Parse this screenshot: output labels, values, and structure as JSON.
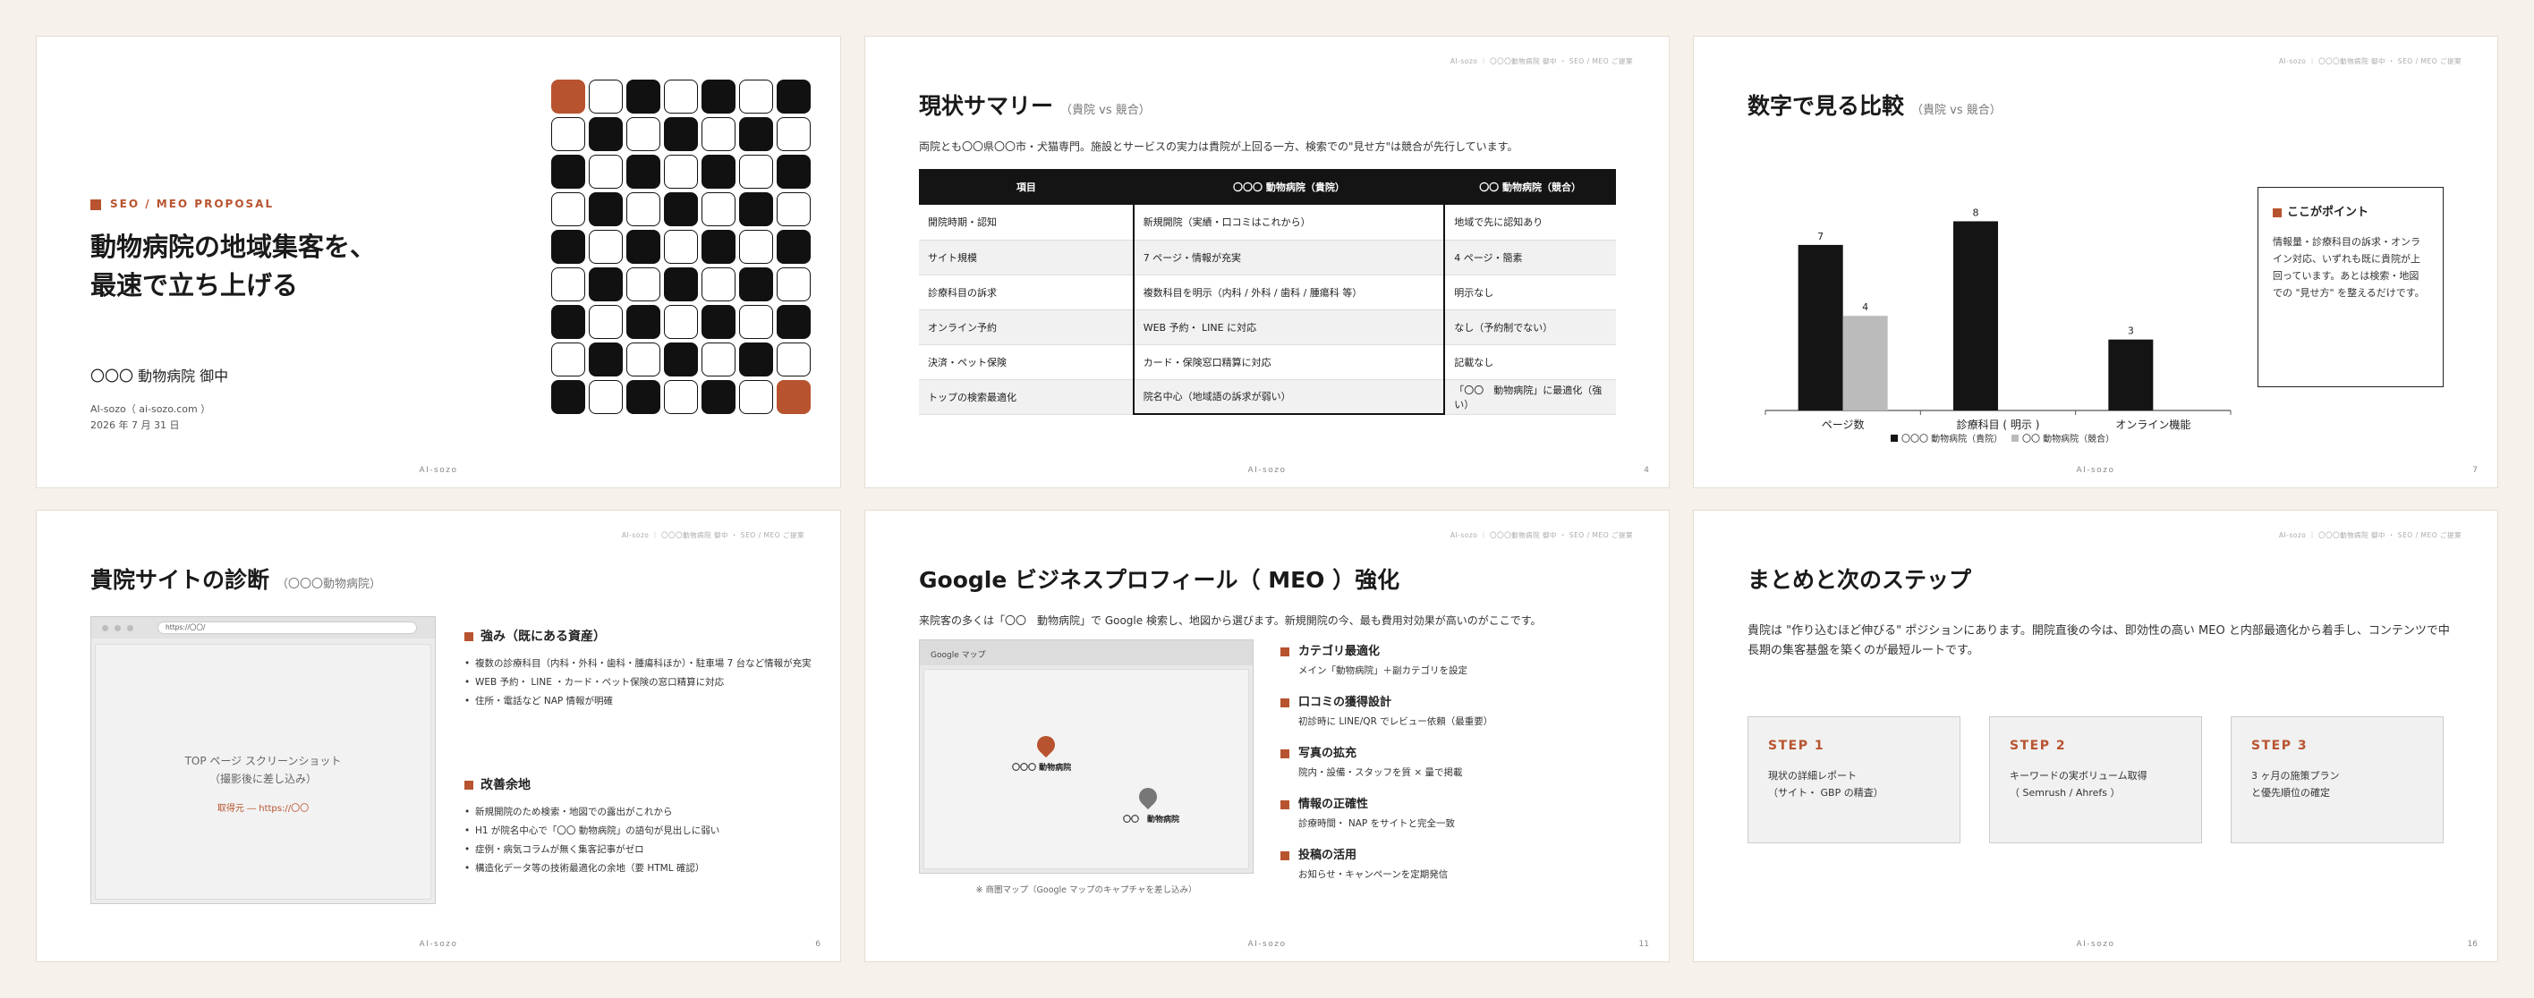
{
  "common": {
    "brand": "AI-sozo",
    "header": "AI-sozo ｜ 〇〇〇動物病院 御中 ・ SEO / MEO ご提案"
  },
  "colors": {
    "accent": "#b8532f",
    "dark": "#141414",
    "gray_bar": "#bbbbbb"
  },
  "s1": {
    "tag": "SEO / MEO PROPOSAL",
    "title_line1": "動物病院の地域集客を、",
    "title_line2": "最速で立ち上げる",
    "client": "〇〇〇 動物病院 御中",
    "author": "AI-sozo（ ai-sozo.com ）",
    "date": "2026 年 7 月 31 日"
  },
  "s2": {
    "title": "現状サマリー",
    "subtitle": "（貴院 vs 競合）",
    "lead": "両院とも〇〇県〇〇市・犬猫専門。施設とサービスの実力は貴院が上回る一方、検索での\"見せ方\"は競合が先行しています。",
    "page": "4",
    "table": {
      "headers": [
        "項目",
        "〇〇〇 動物病院（貴院）",
        "〇〇 動物病院（競合）"
      ],
      "rows": [
        [
          "開院時期・認知",
          "新規開院（実績・口コミはこれから）",
          "地域で先に認知あり"
        ],
        [
          "サイト規模",
          "7 ページ・情報が充実",
          "4 ページ・簡素"
        ],
        [
          "診療科目の訴求",
          "複数科目を明示（内科 / 外科 / 歯科 / 腫瘍科 等）",
          "明示なし"
        ],
        [
          "オンライン予約",
          "WEB 予約・ LINE に対応",
          "なし（予約制でない）"
        ],
        [
          "決済・ペット保険",
          "カード・保険窓口精算に対応",
          "記載なし"
        ],
        [
          "トップの検索最適化",
          "院名中心（地域語の訴求が弱い）",
          "「〇〇　動物病院」に最適化（強い）"
        ]
      ]
    }
  },
  "s3": {
    "title": "数字で見る比較",
    "subtitle": "（貴院 vs 競合）",
    "page": "7",
    "point_title": "ここがポイント",
    "point_text": "情報量・診療科目の訴求・オンライン対応、いずれも既に貴院が上回っています。あとは検索・地図での \"見せ方\" を整えるだけです。"
  },
  "chart_data": {
    "type": "bar",
    "categories": [
      "ページ数",
      "診療科目 ( 明示 )",
      "オンライン機能"
    ],
    "series": [
      {
        "name": "〇〇〇 動物病院（貴院）",
        "values": [
          7,
          8,
          3
        ],
        "color": "#141414"
      },
      {
        "name": "〇〇 動物病院（競合）",
        "values": [
          4,
          0,
          0
        ],
        "color": "#bbbbbb"
      }
    ],
    "data_labels": [
      [
        "7",
        "8",
        "3"
      ],
      [
        "4",
        "",
        ""
      ]
    ],
    "ylim": [
      0,
      9
    ],
    "legend": "bottom",
    "grid": false
  },
  "s4": {
    "title": "貴院サイトの診断",
    "subtitle": "（〇〇〇動物病院）",
    "page": "6",
    "url": "https://〇〇/",
    "placeholder_line1": "TOP ページ スクリーンショット",
    "placeholder_line2": "（撮影後に差し込み）",
    "placeholder_src": "取得元 ― https://〇〇",
    "strengths_title": "強み（既にある資産）",
    "strengths": [
      "複数の診療科目（内科・外科・歯科・腫瘍科ほか）・駐車場 7 台など情報が充実",
      "WEB 予約・ LINE ・カード・ペット保険の窓口精算に対応",
      "住所・電話など NAP 情報が明確"
    ],
    "improve_title": "改善余地",
    "improve": [
      "新規開院のため検索・地図での露出がこれから",
      "H1 が院名中心で「〇〇 動物病院」の語句が見出しに弱い",
      "症例・病気コラムが無く集客記事がゼロ",
      "構造化データ等の技術最適化の余地（要 HTML 確認）"
    ]
  },
  "s5": {
    "title": "Google ビジネスプロフィール（ MEO ）強化",
    "lead": "来院客の多くは「〇〇　動物病院」で Google 検索し、地図から選びます。新規開院の今、最も費用対効果が高いのがここです。",
    "page": "11",
    "map_label": "Google マップ",
    "pin1": "〇〇〇 動物病院",
    "pin2": "〇〇　動物病院",
    "map_note": "※ 商圏マップ（Google マップのキャプチャを差し込み）",
    "items": [
      {
        "title": "カテゴリ最適化",
        "desc": "メイン「動物病院」＋副カテゴリを設定"
      },
      {
        "title": "口コミの獲得設計",
        "desc": "初診時に LINE/QR でレビュー依頼（最重要）"
      },
      {
        "title": "写真の拡充",
        "desc": "院内・設備・スタッフを質 × 量で掲載"
      },
      {
        "title": "情報の正確性",
        "desc": "診療時間・ NAP をサイトと完全一致"
      },
      {
        "title": "投稿の活用",
        "desc": "お知らせ・キャンペーンを定期発信"
      }
    ]
  },
  "s6": {
    "title": "まとめと次のステップ",
    "page": "16",
    "summary": "貴院は \"作り込むほど伸びる\" ポジションにあります。開院直後の今は、即効性の高い MEO と内部最適化から着手し、コンテンツで中長期の集客基盤を築くのが最短ルートです。",
    "steps": [
      {
        "label": "STEP 1",
        "line1": "現状の詳細レポート",
        "line2": "（サイト・ GBP の精査）"
      },
      {
        "label": "STEP 2",
        "line1": "キーワードの実ボリューム取得",
        "line2": "（ Semrush / Ahrefs ）"
      },
      {
        "label": "STEP 3",
        "line1": "3 ヶ月の施策プラン",
        "line2": "と優先順位の確定"
      }
    ]
  }
}
